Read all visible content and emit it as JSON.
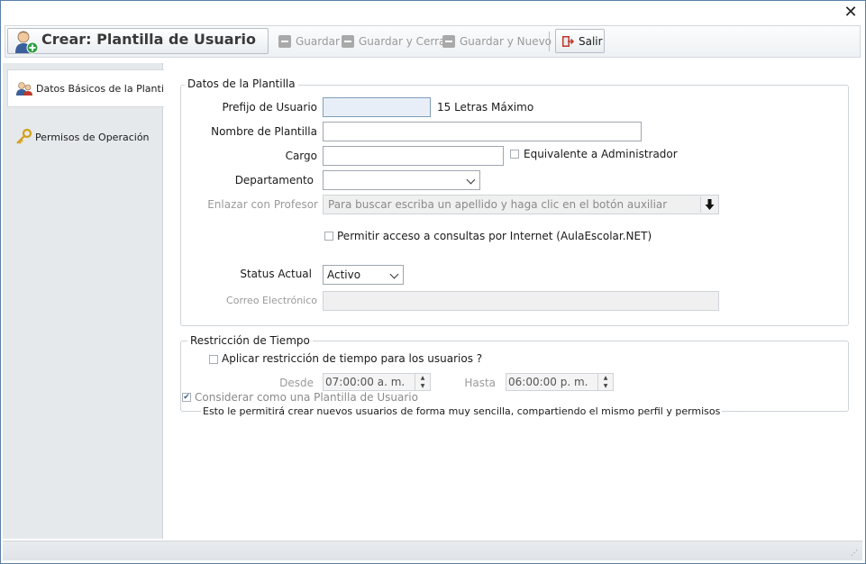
{
  "window": {
    "close_symbol": "✕"
  },
  "toolbar": {
    "title": "Crear: Plantilla de Usuario",
    "guardar": "Guardar",
    "guardar_cerrar": "Guardar y Cerrar",
    "guardar_nuevo": "Guardar y Nuevo",
    "salir": "Salir"
  },
  "sidebar": {
    "items": [
      {
        "label": "Datos Básicos de la Plantilla",
        "icon": "users-icon",
        "active": true
      },
      {
        "label": "Permisos de Operación",
        "icon": "key-icon",
        "active": false
      }
    ]
  },
  "datos": {
    "group_title": "Datos de la Plantilla",
    "prefijo_label": "Prefijo de Usuario",
    "prefijo_value": "",
    "prefijo_hint": "15 Letras Máximo",
    "nombre_label": "Nombre de Plantilla",
    "nombre_value": "",
    "cargo_label": "Cargo",
    "cargo_value": "",
    "equivalente_label": "Equivalente a Administrador",
    "equivalente_checked": false,
    "departamento_label": "Departamento",
    "departamento_value": "",
    "enlazar_label": "Enlazar con Profesor",
    "enlazar_placeholder": "Para buscar escriba un apellido y haga clic en el botón auxiliar",
    "permitir_label": "Permitir acceso a consultas por Internet (AulaEscolar.NET)",
    "permitir_checked": false,
    "status_label": "Status Actual",
    "status_value": "Activo",
    "correo_label": "Correo Electrónico",
    "correo_value": ""
  },
  "restriccion": {
    "group_title": "Restricción de Tiempo",
    "aplicar_label": "Aplicar restricción de tiempo para los usuarios ?",
    "aplicar_checked": false,
    "desde_label": "Desde",
    "desde_value": "07:00:00 a. m.",
    "hasta_label": "Hasta",
    "hasta_value": "06:00:00 p. m.",
    "considerar_label": "Considerar como una Plantilla de Usuario",
    "considerar_checked": true,
    "note": "Esto le permitirá crear nuevos usuarios de forma muy sencilla, compartiendo el mismo perfil y permisos"
  },
  "colors": {
    "accent": "#2f9e44",
    "window_border": "#5a7fa8",
    "panel_bg": "#e6e9ec",
    "focused_input": "#e8eef7"
  }
}
